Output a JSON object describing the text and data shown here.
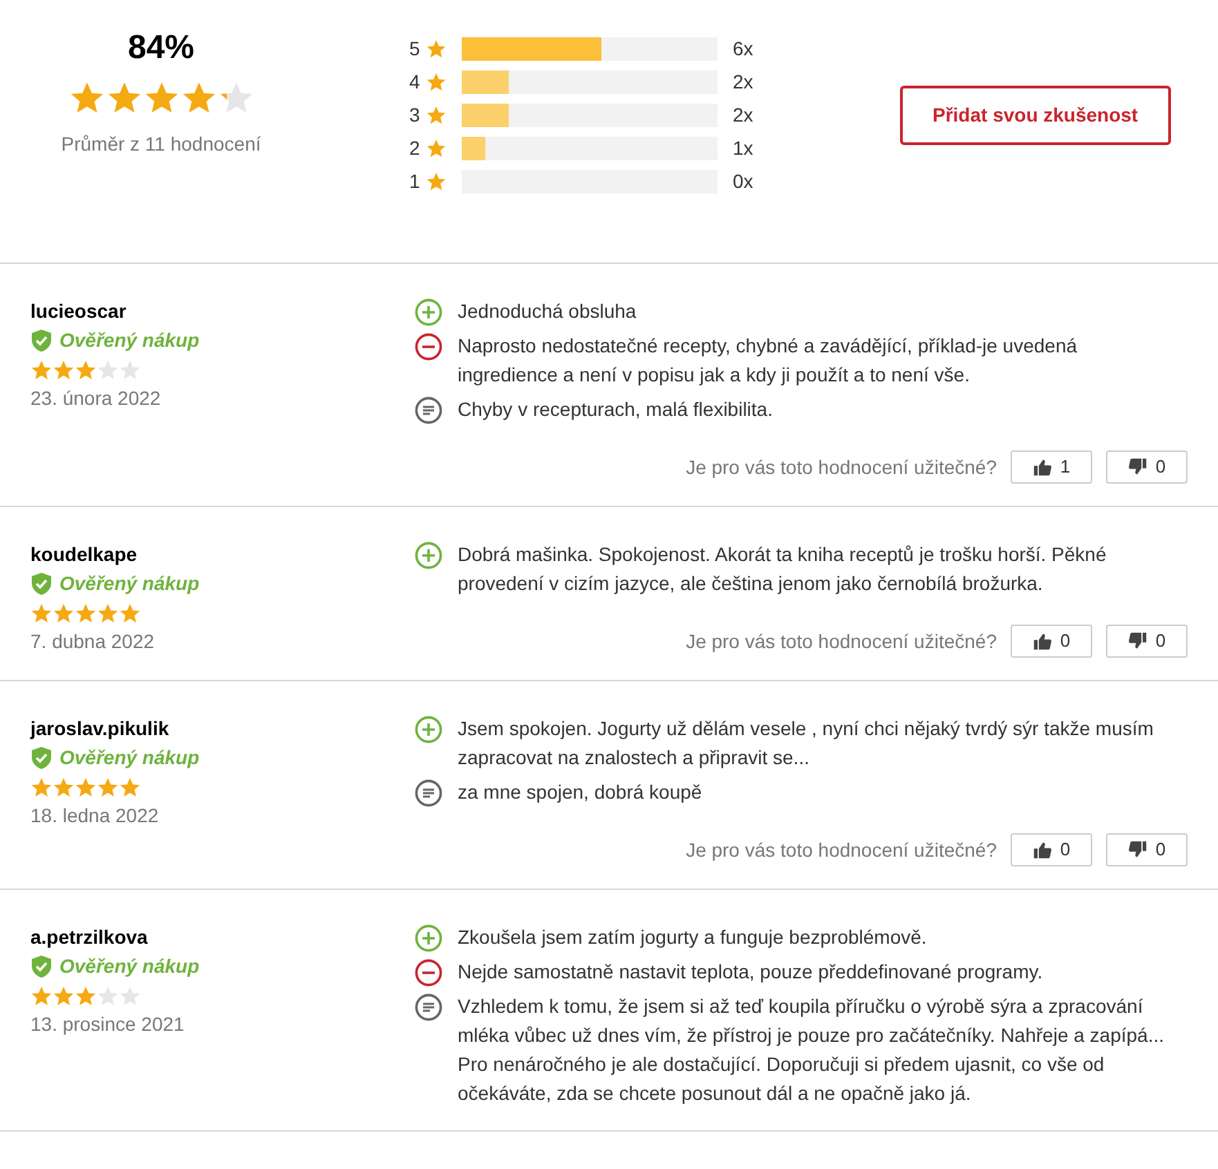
{
  "summary": {
    "percent": "84%",
    "stars": 4.2,
    "caption": "Průměr z 11 hodnocení"
  },
  "distribution": [
    {
      "label": "5",
      "level": 0.545,
      "count": "6x",
      "color": "#fbbf3a"
    },
    {
      "label": "4",
      "level": 0.182,
      "count": "2x",
      "color": "#fcd06a"
    },
    {
      "label": "3",
      "level": 0.182,
      "count": "2x",
      "color": "#fcd06a"
    },
    {
      "label": "2",
      "level": 0.091,
      "count": "1x",
      "color": "#fcd06a"
    },
    {
      "label": "1",
      "count": "0x"
    }
  ],
  "add_button": "Přidat svou zkušenost",
  "reviews": [
    {
      "author": "lucieoscar",
      "verified": "Ověřený nákup",
      "stars": 3,
      "date": "23. února 2022",
      "points": [
        {
          "kind": "pro",
          "text": "Jednoduchá obsluha"
        },
        {
          "kind": "con",
          "text": "Naprosto nedostatečné recepty, chybné a zavádějící, příklad-je uvedená ingredience a není v popisu jak a kdy ji použít a to není vše."
        },
        {
          "kind": "note",
          "text": "Chyby v recepturach, malá flexibilita."
        }
      ],
      "helpful_question": "Je pro vás toto hodnocení užitečné?",
      "likes": "1",
      "dislikes": "0"
    },
    {
      "author": "koudelkape",
      "verified": "Ověřený nákup",
      "stars": 5,
      "date": "7. dubna 2022",
      "points": [
        {
          "kind": "pro",
          "text": "Dobrá mašinka. Spokojenost. Akorát ta kniha receptů je trošku horší. Pěkné provedení v cizím jazyce, ale čeština jenom jako černobílá brožurka."
        }
      ],
      "helpful_question": "Je pro vás toto hodnocení užitečné?",
      "likes": "0",
      "dislikes": "0"
    },
    {
      "author": "jaroslav.pikulik",
      "verified": "Ověřený nákup",
      "stars": 5,
      "date": "18. ledna 2022",
      "points": [
        {
          "kind": "pro",
          "text": "Jsem spokojen. Jogurty už dělám vesele , nyní chci nějaký tvrdý sýr takže musím zapracovat na znalostech a připravit se..."
        },
        {
          "kind": "note",
          "text": "za mne spojen, dobrá koupě"
        }
      ],
      "helpful_question": "Je pro vás toto hodnocení užitečné?",
      "likes": "0",
      "dislikes": "0"
    },
    {
      "author": "a.petrzilkova",
      "verified": "Ověřený nákup",
      "stars": 3,
      "date": "13. prosince 2021",
      "points": [
        {
          "kind": "pro",
          "text": "Zkoušela jsem zatím jogurty a funguje bezproblémově."
        },
        {
          "kind": "con",
          "text": "Nejde samostatně nastavit teplota, pouze předdefinované programy."
        },
        {
          "kind": "note",
          "text": "Vzhledem k tomu, že jsem si až teď koupila příručku o výrobě sýra a zpracování mléka vůbec už dnes vím, že přístroj je pouze pro začátečníky. Nahřeje a zapípá... Pro nenáročného je ale dostačující. Doporučuji si předem ujasnit, co vše od očekáváte, zda se chcete posunout dál a ne opačně jako já."
        }
      ]
    }
  ]
}
